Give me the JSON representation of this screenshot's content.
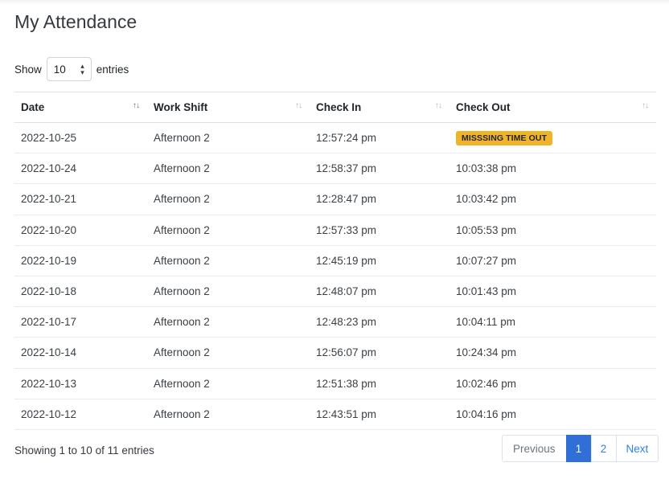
{
  "page_title": "My Attendance",
  "length_menu": {
    "prefix": "Show",
    "selected": "10",
    "suffix": "entries"
  },
  "table": {
    "columns": [
      "Date",
      "Work Shift",
      "Check In",
      "Check Out"
    ],
    "rows": [
      {
        "date": "2022-10-25",
        "shift": "Afternoon 2",
        "check_in": "12:57:24 pm",
        "check_out": "MISSSING TIME OUT",
        "check_out_badge": true
      },
      {
        "date": "2022-10-24",
        "shift": "Afternoon 2",
        "check_in": "12:58:37 pm",
        "check_out": "10:03:38 pm"
      },
      {
        "date": "2022-10-21",
        "shift": "Afternoon 2",
        "check_in": "12:28:47 pm",
        "check_out": "10:03:42 pm"
      },
      {
        "date": "2022-10-20",
        "shift": "Afternoon 2",
        "check_in": "12:57:33 pm",
        "check_out": "10:05:53 pm"
      },
      {
        "date": "2022-10-19",
        "shift": "Afternoon 2",
        "check_in": "12:45:19 pm",
        "check_out": "10:07:27 pm"
      },
      {
        "date": "2022-10-18",
        "shift": "Afternoon 2",
        "check_in": "12:48:07 pm",
        "check_out": "10:01:43 pm"
      },
      {
        "date": "2022-10-17",
        "shift": "Afternoon 2",
        "check_in": "12:48:23 pm",
        "check_out": "10:04:11 pm"
      },
      {
        "date": "2022-10-14",
        "shift": "Afternoon 2",
        "check_in": "12:56:07 pm",
        "check_out": "10:24:34 pm"
      },
      {
        "date": "2022-10-13",
        "shift": "Afternoon 2",
        "check_in": "12:51:38 pm",
        "check_out": "10:02:46 pm"
      },
      {
        "date": "2022-10-12",
        "shift": "Afternoon 2",
        "check_in": "12:43:51 pm",
        "check_out": "10:04:16 pm"
      }
    ]
  },
  "info_text": "Showing 1 to 10 of 11 entries",
  "pagination": {
    "previous": "Previous",
    "pages": [
      "1",
      "2"
    ],
    "active_page": "1",
    "next": "Next"
  },
  "icons": {
    "sort": "sort-arrows-icon",
    "select_caret": "select-caret-icon"
  },
  "colors": {
    "badge_warning": "#f0b429",
    "primary": "#2f6fd6",
    "link": "#2f80ed"
  }
}
